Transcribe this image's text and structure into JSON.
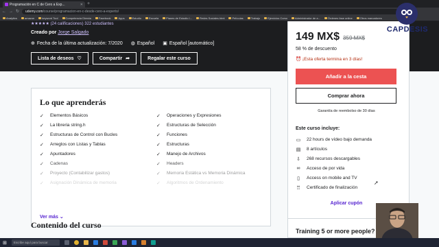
{
  "browser": {
    "tab_title": "Programación en C de Cero a Exp...",
    "url_host": "udemy.com",
    "url_path": "/course/programacion-en-c-desde-cero-a-experto/",
    "bookmarks": [
      "Analytics",
      "amazon",
      "keyword Tool",
      "Competencia Directa",
      "Facebook",
      "Apps",
      "Estudio",
      "Escuela",
      "Planes de Estudio I...",
      "Redes Sociales.html",
      "Películas",
      "Trabajo",
      "Ejercicios Curso",
      "Administrador de a...",
      "Órdenes fase online",
      "Otros marcadores"
    ]
  },
  "hero": {
    "rating_line": "(24 calificaciones) 322 estudiantes",
    "creator_label": "Creado por",
    "creator_name": "Jorge Salgado",
    "updated": "Fecha de la última actualización: 7/2020",
    "language": "Español",
    "captions": "Español [automático]",
    "wishlist_label": "Lista de deseos",
    "share_label": "Compartir",
    "gift_label": "Regalar este curso"
  },
  "learn": {
    "title": "Lo que aprenderás",
    "left": [
      "Elementos Básicos",
      "La libreria string.h",
      "Estructuras de Control con Bucles",
      "Arreglos con Listas y Tablas",
      "Apuntadores",
      "Cadenas",
      "Proyecto (Contabilizar gastos)",
      "Asignación Dinámica de memoria"
    ],
    "right": [
      "Operaciones y Expresiones",
      "Estructuras de Selección",
      "Funciones",
      "Estructuras",
      "Manejo de Archivos",
      "Headers",
      "Memoria Estática vs Memoria Dinámica",
      "Algoritmos de Ordenamiento"
    ],
    "see_more": "Ver más"
  },
  "contents_title": "Contenido del curso",
  "sidebar": {
    "price": "149 MX$",
    "old_price": "359 MX$",
    "discount": "58 % de descuento",
    "offer": "¡Esta oferta termina en 3 días!",
    "add_to_cart": "Añadir a la cesta",
    "buy_now": "Comprar ahora",
    "refund": "Garantía de reembolso de 30 días",
    "includes_title": "Este curso incluye:",
    "includes": [
      "22 hours de vídeo bajo demanda",
      "8 artículos",
      "268 recursos descargables",
      "Acceso de por vida",
      "Access on mobile and TV",
      "Certificado de finalización"
    ],
    "coupon": "Aplicar cupón",
    "training": "Training 5 or more people?"
  },
  "logo": {
    "text": "CAPDESIS"
  },
  "taskbar": {
    "search_placeholder": "Escribe aquí para buscar"
  },
  "colors": {
    "accent": "#5624d0",
    "cta": "#ec5252",
    "hero_bg": "#1c1d1f",
    "offer": "#b32d0f"
  }
}
